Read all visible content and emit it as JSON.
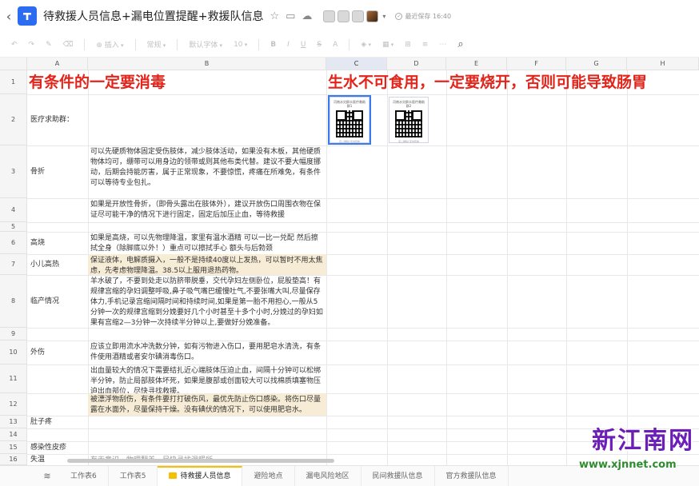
{
  "header": {
    "title": "待救援人员信息+漏电位置提醒+救援队信息",
    "saved_text": "最近保存 16:40"
  },
  "toolbar": {
    "insert": "插入",
    "format": "常规",
    "font": "默认字体",
    "font_size": "10"
  },
  "columns": [
    "A",
    "B",
    "C",
    "D",
    "E",
    "F",
    "G",
    "H"
  ],
  "rows": [
    "1",
    "2",
    "3",
    "4",
    "5",
    "6",
    "7",
    "8",
    "9",
    "10",
    "11",
    "12",
    "13",
    "14",
    "15",
    "16"
  ],
  "cells": {
    "r1_a": "有条件的一定要消毒",
    "r1_c": "生水不可食用，一定要烧开，否则可能导致肠胃",
    "r2_a": "医疗求助群：",
    "r3_a": "骨折",
    "r3_b": "可以先硬质物体固定受伤肢体，减少肢体活动，如果没有木板，其他硬质物体均可，绷带可以用身边的领带或则其他布类代替。建议不要大幅度挪动，后期会持能厉害，属于正常现象，不要惊慌，疼痛在所难免，有条件可以等待专业包扎。",
    "r4_b": "如果是开放性骨折，（即骨头露出在肢体外），建议开放伤口周围衣物在保证尽可能干净的情况下进行固定，固定后加压止血，等待救援",
    "r6_a": "高烧",
    "r6_b": "如果是高烧，可以先物理降温，家里有温水酒精 可以一比一兑配 然后擦拭全身（除脚底以外！）重点可以擦拭手心 额头与后勃颈",
    "r7_a": "小儿高热",
    "r7_b": "保证液体，电解质摄入，一般不是持续40度以上发热，可以暂时不用太焦虑，先考虑物理降温。38.5以上服用退热药物。",
    "r8_a": "临产情况",
    "r8_b": "羊水破了，不要到处走以防脐带脱垂，交代孕妇左侧卧位，屁股垫高！有规律宫缩的孕妇调整呼吸,鼻子吸气嘴巴缓慢吐气,不要张嘴大叫,尽量保存体力,手机记录宫缩间隔时间和持续时间,如果是第一胎不用担心,一般从5分钟一次的规律宫缩到分娩要好几个小时甚至十多个小时,分娩过的孕妇如果有宫缩2—3分钟一次持续半分钟以上,要做好分娩准备。",
    "r10_a": "外伤",
    "r10_b": "应该立即用流水冲洗数分钟，如有污物进入伤口，要用肥皂水清洗，有条件使用酒精或者安尔碘消毒伤口。",
    "r11_b": "出血量较大的情况下需要结扎近心端肢体压迫止血，间隔十分钟可以松绑半分钟，防止局部肢体坏死，如果是腹部或创面较大可以找棉质填塞物压迫出血部位，尽快寻找救援。",
    "r12_b": "被漂浮物刮伤，有条件要打打破伤风，最优先防止伤口感染。将伤口尽量露在水面外，尽量保持干燥。没有碘伏的情况下，可以使用肥皂水。",
    "r13_a": "肚子疼",
    "r15_a": "感染性皮疹",
    "r16_a": "失温",
    "r16_b": "有无意识、物理翻盖，尽快寻找温暖所。"
  },
  "qr": {
    "c2_caption": "河南水灾群众医疗救助群1",
    "d2_caption": "河南水灾群众医疗救助群2",
    "footer": "该二维码7天内有效"
  },
  "tabs": [
    "工作表6",
    "工作表5",
    "待救援人员信息",
    "避险地点",
    "漏电风险地区",
    "民间救援队信息",
    "官方救援队信息"
  ],
  "watermark": {
    "text": "新江南网",
    "url": "www.xjnnet.com"
  },
  "colors": {
    "red_text": "#e2241a",
    "highlight": "#f7ecd6",
    "accent": "#2b6cf0",
    "watermark": "#6b1fb6"
  }
}
